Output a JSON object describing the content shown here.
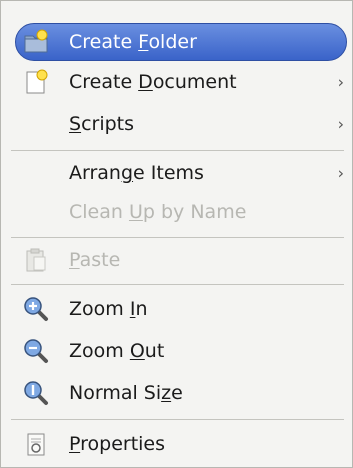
{
  "menu": {
    "items": [
      {
        "label_pre": "Create ",
        "label_u": "F",
        "label_post": "older",
        "icon": "folder-new-icon",
        "has_submenu": false,
        "disabled": false,
        "active": true
      },
      {
        "label_pre": "Create ",
        "label_u": "D",
        "label_post": "ocument",
        "icon": "document-new-icon",
        "has_submenu": true,
        "disabled": false,
        "active": false
      },
      {
        "label_pre": "",
        "label_u": "S",
        "label_post": "cripts",
        "icon": "",
        "has_submenu": true,
        "disabled": false,
        "active": false
      },
      {
        "label_pre": "Arran",
        "label_u": "g",
        "label_post": "e Items",
        "icon": "",
        "has_submenu": true,
        "disabled": false,
        "active": false
      },
      {
        "label_pre": "Clean ",
        "label_u": "U",
        "label_post": "p by Name",
        "icon": "",
        "has_submenu": false,
        "disabled": true,
        "active": false
      },
      {
        "label_pre": "",
        "label_u": "P",
        "label_post": "aste",
        "icon": "paste-icon",
        "has_submenu": false,
        "disabled": true,
        "active": false
      },
      {
        "label_pre": "Zoom ",
        "label_u": "I",
        "label_post": "n",
        "icon": "zoom-in-icon",
        "has_submenu": false,
        "disabled": false,
        "active": false
      },
      {
        "label_pre": "Zoom ",
        "label_u": "O",
        "label_post": "ut",
        "icon": "zoom-out-icon",
        "has_submenu": false,
        "disabled": false,
        "active": false
      },
      {
        "label_pre": "Normal Si",
        "label_u": "z",
        "label_post": "e",
        "icon": "zoom-normal-icon",
        "has_submenu": false,
        "disabled": false,
        "active": false
      },
      {
        "label_pre": "",
        "label_u": "P",
        "label_post": "roperties",
        "icon": "properties-icon",
        "has_submenu": false,
        "disabled": false,
        "active": false
      }
    ],
    "submenu_arrow": "›"
  }
}
